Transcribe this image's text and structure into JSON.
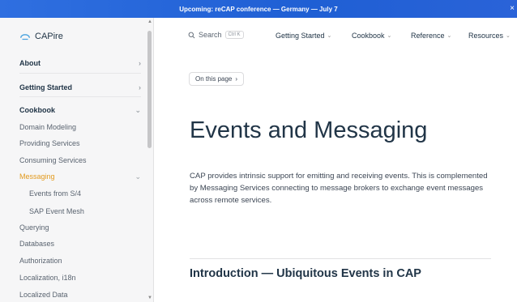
{
  "banner": {
    "text": "Upcoming: reCAP conference — Germany — July 7",
    "close": "×"
  },
  "sidebar": {
    "logo": "CAPire",
    "items": [
      {
        "label": "About",
        "type": "section",
        "chevron": ">"
      },
      {
        "label": "Getting Started",
        "type": "section",
        "chevron": ">"
      },
      {
        "label": "Cookbook",
        "type": "section",
        "chevron": "v"
      },
      {
        "label": "Domain Modeling",
        "type": "link"
      },
      {
        "label": "Providing Services",
        "type": "link"
      },
      {
        "label": "Consuming Services",
        "type": "link"
      },
      {
        "label": "Messaging",
        "type": "active",
        "chevron": "v"
      },
      {
        "label": "Events from S/4",
        "type": "sub"
      },
      {
        "label": "SAP Event Mesh",
        "type": "sub"
      },
      {
        "label": "Querying",
        "type": "link"
      },
      {
        "label": "Databases",
        "type": "link"
      },
      {
        "label": "Authorization",
        "type": "link"
      },
      {
        "label": "Localization, i18n",
        "type": "link"
      },
      {
        "label": "Localized Data",
        "type": "link"
      }
    ]
  },
  "topnav": {
    "search_label": "Search",
    "search_kbd": "Ctrl K",
    "menus": [
      "Getting Started",
      "Cookbook",
      "Reference",
      "Resources"
    ]
  },
  "main": {
    "on_this_page": "On this page",
    "title": "Events and Messaging",
    "intro": "CAP provides intrinsic support for emitting and receiving events. This is complemented by Messaging Services connecting to message brokers to exchange event messages across remote services.",
    "h2": "Introduction — Ubiquitous Events in CAP"
  },
  "colors": {
    "accent": "#e29a1e",
    "banner": "#2a63d8"
  }
}
